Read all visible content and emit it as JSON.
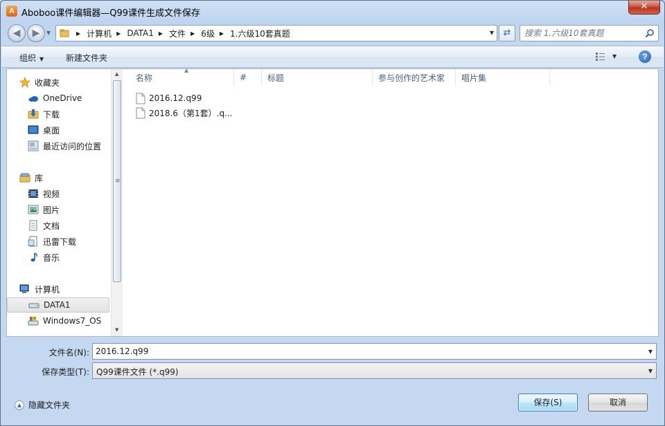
{
  "window": {
    "title": "Aboboo课件编辑器—Q99课件生成文件保存",
    "app_icon_letter": "A",
    "close_glyph": "✕"
  },
  "address": {
    "crumbs": [
      "计算机",
      "DATA1",
      "文件",
      "6级",
      "1.六级10套真题"
    ],
    "search_placeholder": "搜索 1.六级10套真题"
  },
  "toolbar": {
    "organize_label": "组织",
    "new_folder_label": "新建文件夹",
    "help_glyph": "?"
  },
  "nav_pane": {
    "favorites_header": "收藏夹",
    "favorites": [
      "OneDrive",
      "下载",
      "桌面",
      "最近访问的位置"
    ],
    "libraries_header": "库",
    "libraries": [
      "视频",
      "图片",
      "文档",
      "迅雷下载",
      "音乐"
    ],
    "computer_header": "计算机",
    "drives": [
      "DATA1",
      "Windows7_OS"
    ],
    "selected": "DATA1"
  },
  "file_list": {
    "columns": [
      "名称",
      "#",
      "标题",
      "参与创作的艺术家",
      "唱片集"
    ],
    "files": [
      "2016.12.q99",
      "2018.6（第1套）.q..."
    ]
  },
  "save_form": {
    "filename_label": "文件名(N):",
    "filename_value": "2016.12.q99",
    "filetype_label": "保存类型(T):",
    "filetype_value": "Q99课件文件 (*.q99)",
    "hide_folders_label": "隐藏文件夹",
    "save_button": "保存(S)",
    "cancel_button": "取消"
  },
  "colors": {
    "accent": "#3c7fb1",
    "title_close": "#c74b34"
  }
}
